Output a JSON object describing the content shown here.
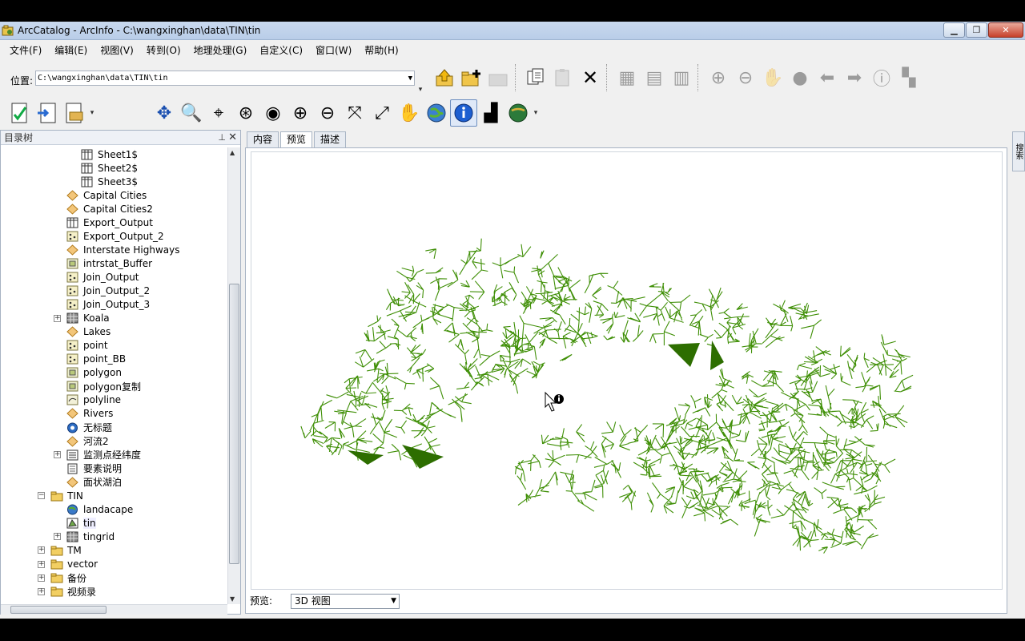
{
  "window": {
    "title": "ArcCatalog - ArcInfo - C:\\wangxinghan\\data\\TIN\\tin"
  },
  "menu": [
    "文件(F)",
    "编辑(E)",
    "视图(V)",
    "转到(O)",
    "地理处理(G)",
    "自定义(C)",
    "窗口(W)",
    "帮助(H)"
  ],
  "location": {
    "label": "位置:",
    "value": "C:\\wangxinghan\\data\\TIN\\tin"
  },
  "tree": {
    "title": "目录树",
    "items": [
      {
        "label": "Sheet1$",
        "icon": "table-icon",
        "depth": 3
      },
      {
        "label": "Sheet2$",
        "icon": "table-icon",
        "depth": 3
      },
      {
        "label": "Sheet3$",
        "icon": "table-icon",
        "depth": 3
      },
      {
        "label": "Capital Cities",
        "icon": "shapefile-icon",
        "depth": 2
      },
      {
        "label": "Capital Cities2",
        "icon": "shapefile-icon",
        "depth": 2
      },
      {
        "label": "Export_Output",
        "icon": "table-icon",
        "depth": 2
      },
      {
        "label": "Export_Output_2",
        "icon": "point-feature-icon",
        "depth": 2
      },
      {
        "label": "Interstate Highways",
        "icon": "shapefile-icon",
        "depth": 2
      },
      {
        "label": "intrstat_Buffer",
        "icon": "polygon-feature-icon",
        "depth": 2
      },
      {
        "label": "Join_Output",
        "icon": "point-feature-icon",
        "depth": 2
      },
      {
        "label": "Join_Output_2",
        "icon": "point-feature-icon",
        "depth": 2
      },
      {
        "label": "Join_Output_3",
        "icon": "point-feature-icon",
        "depth": 2
      },
      {
        "label": "Koala",
        "icon": "raster-icon",
        "depth": 2,
        "expander": "+"
      },
      {
        "label": "Lakes",
        "icon": "shapefile-icon",
        "depth": 2
      },
      {
        "label": "point",
        "icon": "point-feature-icon",
        "depth": 2
      },
      {
        "label": "point_BB",
        "icon": "point-feature-icon",
        "depth": 2
      },
      {
        "label": "polygon",
        "icon": "polygon-feature-icon",
        "depth": 2
      },
      {
        "label": "polygon复制",
        "icon": "polygon-feature-icon",
        "depth": 2
      },
      {
        "label": "polyline",
        "icon": "line-feature-icon",
        "depth": 2
      },
      {
        "label": "Rivers",
        "icon": "shapefile-icon",
        "depth": 2
      },
      {
        "label": "无标题",
        "icon": "layer-icon",
        "depth": 2
      },
      {
        "label": "河流2",
        "icon": "shapefile-icon",
        "depth": 2
      },
      {
        "label": "监测点经纬度",
        "icon": "dataset-icon",
        "depth": 2,
        "expander": "+"
      },
      {
        "label": "要素说明",
        "icon": "document-icon",
        "depth": 2
      },
      {
        "label": "面状湖泊",
        "icon": "shapefile-icon",
        "depth": 2
      },
      {
        "label": "TIN",
        "icon": "folder-icon",
        "depth": 1,
        "expander": "−"
      },
      {
        "label": "landacape",
        "icon": "globe-icon",
        "depth": 2
      },
      {
        "label": "tin",
        "icon": "tin-icon",
        "depth": 2,
        "selected": true
      },
      {
        "label": "tingrid",
        "icon": "raster-icon",
        "depth": 2,
        "expander": "+"
      },
      {
        "label": "TM",
        "icon": "folder-icon",
        "depth": 1,
        "expander": "+"
      },
      {
        "label": "vector",
        "icon": "folder-icon",
        "depth": 1,
        "expander": "+"
      },
      {
        "label": "备份",
        "icon": "folder-icon",
        "depth": 1,
        "expander": "+"
      },
      {
        "label": "视频录",
        "icon": "folder-icon",
        "depth": 1,
        "expander": "+"
      }
    ]
  },
  "tabs": [
    {
      "label": "内容",
      "active": false
    },
    {
      "label": "预览",
      "active": true
    },
    {
      "label": "描述",
      "active": false
    }
  ],
  "preview": {
    "label": "预览:",
    "mode": "3D 视图"
  },
  "right_dock": {
    "label": "搜索"
  },
  "colors": {
    "tin_green": "#3f8f06",
    "tin_dark": "#2d6e00"
  }
}
